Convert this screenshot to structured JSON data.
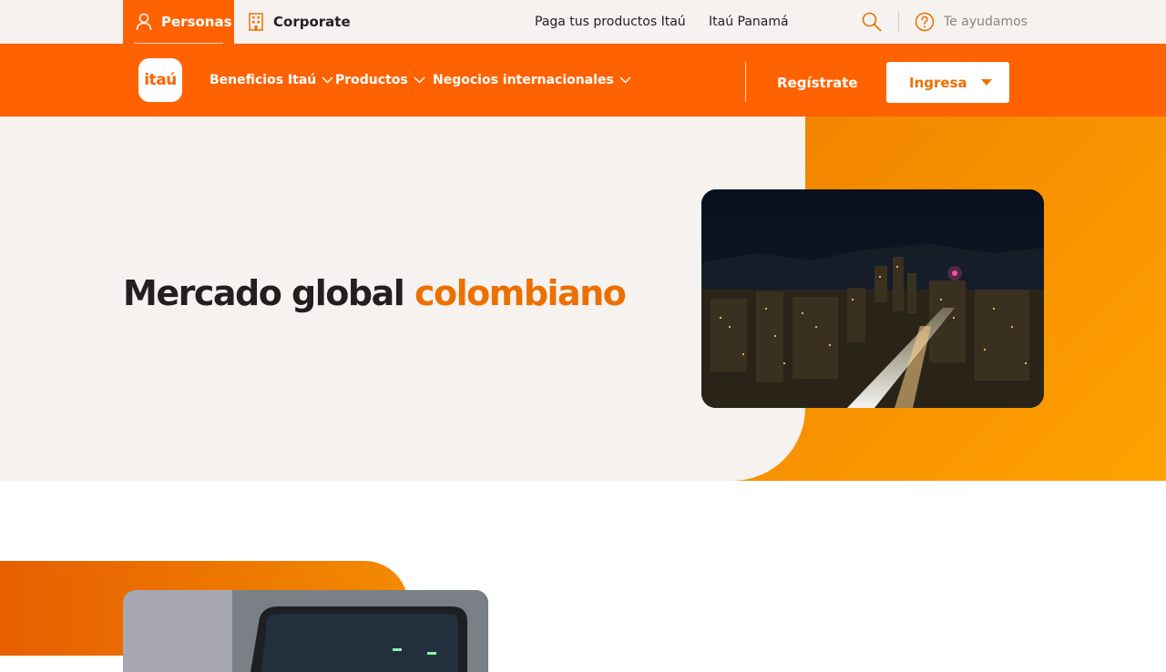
{
  "topbar": {
    "personas_label": "Personas",
    "corporate_label": "Corporate",
    "links": [
      "Paga tus productos Itaú",
      "Itaú Panamá"
    ],
    "help_label": "Te ayudamos"
  },
  "navbar": {
    "logo_text": "itaú",
    "items": [
      "Beneficios Itaú",
      "Productos",
      "Negocios internacionales"
    ],
    "register_label": "Regístrate",
    "login_label": "Ingresa"
  },
  "hero": {
    "title_main": "Mercado global",
    "title_accent": "colombiano"
  },
  "colors": {
    "brand_orange": "#ff6200",
    "accent_orange": "#ec7000",
    "cream": "#f5f2ef"
  },
  "icons": [
    "person-icon",
    "building-icon",
    "search-icon",
    "help-icon",
    "chevron-down-icon",
    "caret-down-icon"
  ]
}
